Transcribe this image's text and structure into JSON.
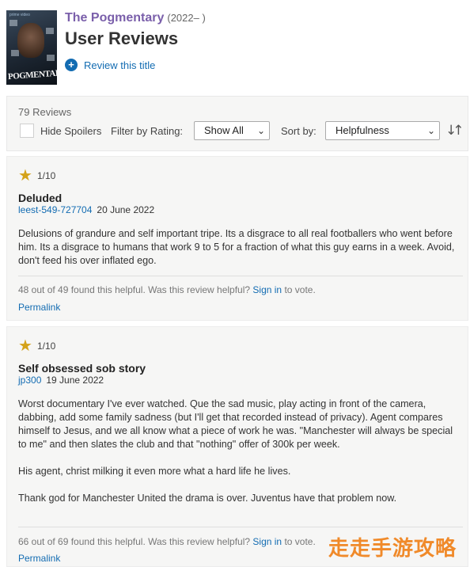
{
  "header": {
    "show_title": "The Pogmentary",
    "show_years": "(2022– )",
    "page_title": "User Reviews",
    "review_link": "Review this title",
    "poster_brand": "prime video",
    "poster_title": "POGMENTARY"
  },
  "filters": {
    "review_count": "79 Reviews",
    "hide_spoilers": "Hide Spoilers",
    "filter_label": "Filter by Rating:",
    "filter_value": "Show All",
    "sort_label": "Sort by:",
    "sort_value": "Helpfulness"
  },
  "reviews": [
    {
      "rating": "1/10",
      "title": "Deluded",
      "author": "leest-549-727704",
      "date": "20 June 2022",
      "body": [
        "Delusions of grandure and self important tripe. Its a disgrace to all real footballers who went before him. Its a disgrace to humans that work 9 to 5 for a fraction of what this guy earns in a week. Avoid, don't feed his over inflated ego."
      ],
      "helpful_prefix": "48 out of 49 found this helpful. Was this review helpful?",
      "sign_in": "Sign in",
      "helpful_suffix": "to vote.",
      "permalink": "Permalink"
    },
    {
      "rating": "1/10",
      "title": "Self obsessed sob story",
      "author": "jp300",
      "date": "19 June 2022",
      "body": [
        "Worst documentary I've ever watched. Que the sad music, play acting in front of the camera, dabbing, add some family sadness (but I'll get that recorded instead of privacy). Agent compares himself to Jesus, and we all know what a piece of work he was. \"Manchester will always be special to me\" and then slates the club and that \"nothing\" offer of 300k per week.",
        "His agent, christ milking it even more what a hard life he lives.",
        "Thank god for Manchester United the drama is over. Juventus have that problem now."
      ],
      "helpful_prefix": "66 out of 69 found this helpful. Was this review helpful?",
      "sign_in": "Sign in",
      "helpful_suffix": "to vote.",
      "permalink": "Permalink"
    }
  ],
  "watermark": "走走手游攻略",
  "colors": {
    "link": "#136cb2",
    "show_title": "#7a5faa",
    "star": "#d4a21a",
    "panel_bg": "#f6f6f5"
  },
  "icons": [
    "plus-circle-icon",
    "star-icon",
    "chevron-down-icon",
    "sort-direction-icon"
  ]
}
